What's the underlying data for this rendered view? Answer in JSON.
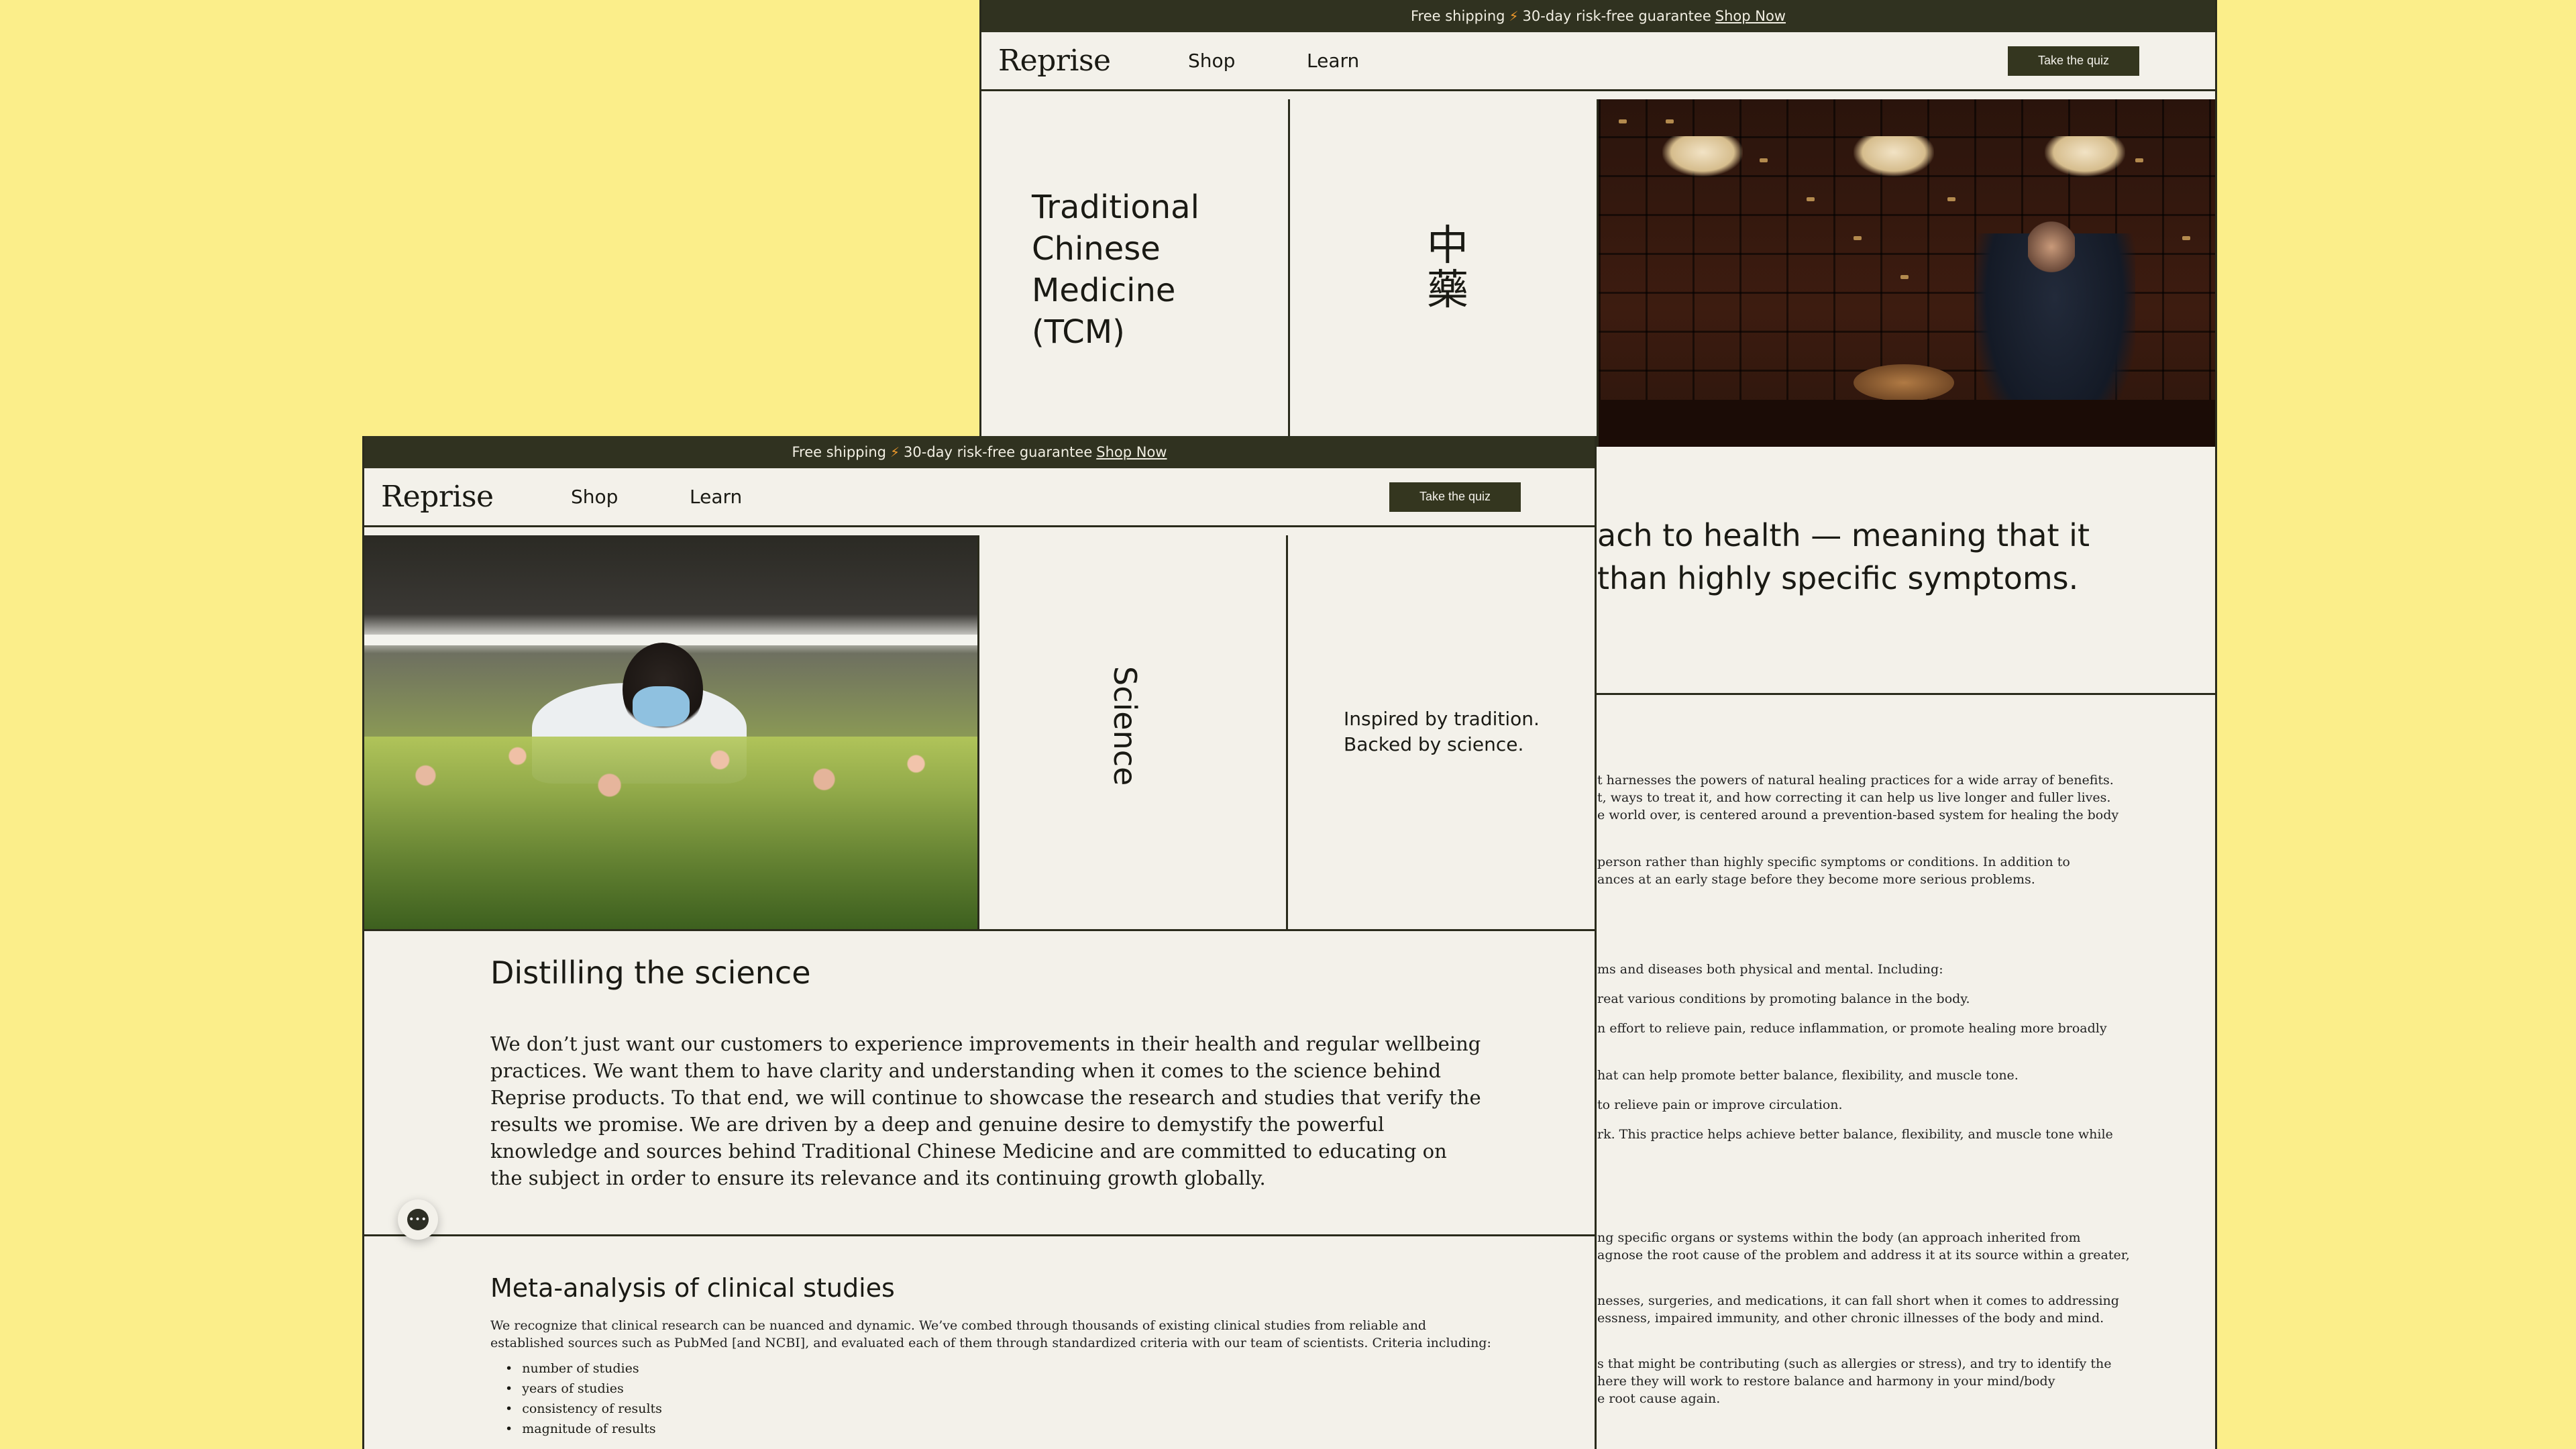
{
  "announcement": {
    "text": "Free shipping",
    "bolt": "⚡",
    "guarantee": "30-day risk-free guarantee",
    "link": "Shop Now"
  },
  "nav": {
    "logo": "Reprise",
    "shop": "Shop",
    "learn": "Learn",
    "quiz": "Take the quiz"
  },
  "back_page": {
    "title_lines": [
      "Traditional",
      "Chinese",
      "Medicine",
      "(TCM)"
    ],
    "hanzi": [
      "中",
      "藥"
    ],
    "lead_lines": [
      "ach to health — meaning that it",
      "than highly specific symptoms."
    ],
    "body": [
      "t harnesses the powers of natural healing practices for a wide array of benefits.",
      "t, ways to treat it, and how correcting it can help us live longer and fuller lives.",
      "e world over, is centered around a prevention-based system for healing the body",
      "person rather than highly specific symptoms or conditions. In addition to",
      "ances at an early stage before they become more serious problems.",
      "ms and diseases both physical and mental. Including:",
      "reat various conditions by promoting balance in the body.",
      "n effort to relieve pain, reduce inflammation, or promote healing more broadly",
      "hat can help promote better balance, flexibility, and muscle tone.",
      "to relieve pain or improve circulation.",
      "rk. This practice helps achieve better balance, flexibility, and muscle tone while",
      "ng specific organs or systems within the body (an approach inherited from",
      "agnose the root cause of the problem and address it at its source within a greater,",
      "nesses, surgeries, and medications, it can fall short when it comes to addressing",
      "essness, impaired immunity, and other chronic illnesses of the body and mind.",
      "s that might be contributing (such as allergies or stress), and try to identify the",
      "here they will work to restore balance and harmony in your mind/body",
      "e root cause again."
    ]
  },
  "front_page": {
    "science_label": "Science",
    "tagline_lines": [
      "Inspired by tradition.",
      "Backed by science."
    ],
    "distill_title": "Distilling the science",
    "distill_body": "We don’t just want our customers to experience improvements in their health and regular wellbeing practices. We want them to have clarity and understanding when it comes to the science behind Reprise products. To that end, we will continue to showcase the research and studies that verify the results we promise. We are driven by a deep and genuine desire to demystify the powerful knowledge and sources behind Traditional Chinese Medicine and are committed to educating on the subject in order to ensure its relevance and its continuing growth globally.",
    "meta_title": "Meta-analysis of clinical studies",
    "meta_body": "We recognize that clinical research can be nuanced and dynamic. We’ve combed through thousands of existing clinical studies from reliable and established sources such as PubMed [and NCBI], and evaluated each of them through standardized criteria with our team of scientists. Criteria including:",
    "meta_list": [
      "number of studies",
      "years of studies",
      "consistency of results",
      "magnitude of results"
    ]
  },
  "colors": {
    "background": "#fbee8a",
    "page": "#f3f1ea",
    "dark": "#303220",
    "accent_bolt": "#f09a2b"
  }
}
